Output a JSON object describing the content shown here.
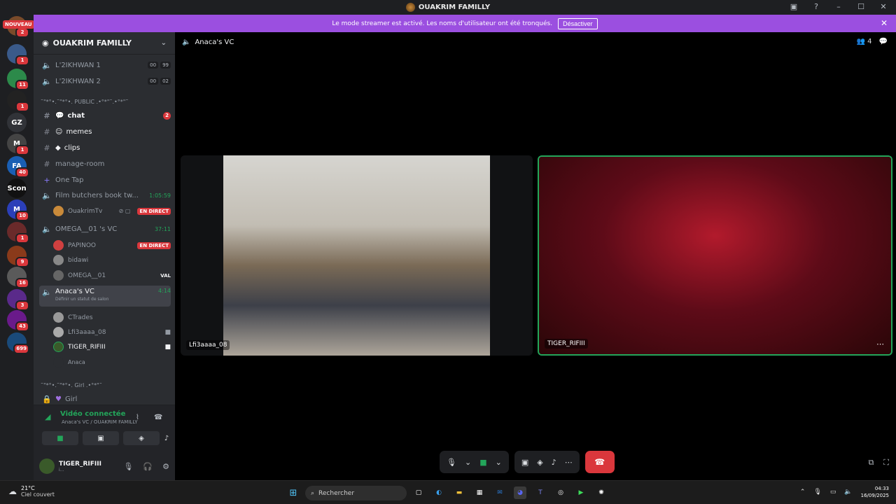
{
  "window": {
    "title": "OUAKRIM FAMILLY"
  },
  "rail": {
    "new_label": "NOUVEAU",
    "servers": [
      {
        "label": "",
        "badge": "2",
        "color": "#7a4a2a"
      },
      {
        "label": "",
        "badge": "1",
        "color": "#3a5a8a"
      },
      {
        "label": "",
        "badge": "11",
        "color": "#2c8a4a"
      },
      {
        "label": "",
        "badge": "1",
        "color": "#222222"
      },
      {
        "label": "GZ",
        "badge": "",
        "color": "#313338"
      },
      {
        "label": "M",
        "badge": "1",
        "color": "#444444"
      },
      {
        "label": "FA",
        "badge": "40",
        "color": "#1a5fb4"
      },
      {
        "label": "Scon",
        "badge": "",
        "color": "#111111"
      },
      {
        "label": "M",
        "badge": "10",
        "color": "#2b3fb8"
      },
      {
        "label": "",
        "badge": "1",
        "color": "#6a2a2a"
      },
      {
        "label": "",
        "badge": "9",
        "color": "#8a3a1a"
      },
      {
        "label": "",
        "badge": "16",
        "color": "#5a5a5a"
      },
      {
        "label": "",
        "badge": "3",
        "color": "#5a2a8a"
      },
      {
        "label": "",
        "badge": "43",
        "color": "#6a1a8a"
      },
      {
        "label": "",
        "badge": "699",
        "color": "#1a4a7a"
      }
    ]
  },
  "banner": {
    "text": "Le mode streamer est activé. Les noms d'utilisateur ont été tronqués.",
    "button": "Désactiver"
  },
  "sidebar": {
    "server_name": "OUAKRIM FAMILLY",
    "channels_top": [
      {
        "name": "L'2IKHWAN 1",
        "c1": "00",
        "c2": "99"
      },
      {
        "name": "L'2IKHWAN 2",
        "c1": "00",
        "c2": "02"
      }
    ],
    "category_public": "˜\"*°•.˜\"*°•. PUBLIC .•°*\"˜.•°*\"˜",
    "text_channels": [
      {
        "name": "chat",
        "mention": "2"
      },
      {
        "name": "memes",
        "mention": ""
      },
      {
        "name": "clips",
        "mention": ""
      },
      {
        "name": "manage-room",
        "mention": ""
      },
      {
        "name": "One Tap",
        "mention": ""
      }
    ],
    "voice1": {
      "name": "Film butchers book tw...",
      "time": "1:05:59"
    },
    "voice1_users": [
      {
        "name": "OuakrimTv",
        "live": "EN DIRECT"
      }
    ],
    "voice2": {
      "name": "OMEGA__01 's VC",
      "time": "37:11"
    },
    "voice2_users": [
      {
        "name": "PAPINOO",
        "tag": "EN DIRECT"
      },
      {
        "name": "bidawi",
        "tag": ""
      },
      {
        "name": "OMEGA__01",
        "tag": "VAL"
      }
    ],
    "voice3": {
      "name": "Anaca's VC",
      "time": "4:14",
      "status": "Définir un statut de salon"
    },
    "voice3_users": [
      {
        "name": "CTrades"
      },
      {
        "name": "Lfi3aaaa_08"
      },
      {
        "name": "TIGER_RIFIII"
      },
      {
        "name": "Anaca"
      }
    ],
    "category_girl": "˜\"*°•.˜\"*°•. Girl .•°*\"˜",
    "girl_channel": "Girl"
  },
  "voice_panel": {
    "status": "Vidéo connectée",
    "sub": "Anaca's VC / OUAKRIM FAMILLY"
  },
  "user_panel": {
    "name": "TIGER_RIFIII",
    "status": "i..."
  },
  "main": {
    "channel_title": "Anaca's VC",
    "member_count": "4",
    "tiles": [
      {
        "name": "Lfi3aaaa_08"
      },
      {
        "name": "TIGER_RIFIII"
      }
    ]
  },
  "taskbar": {
    "temp": "21°C",
    "condition": "Ciel couvert",
    "search_placeholder": "Rechercher",
    "time": "04:33",
    "date": "16/09/2025"
  }
}
